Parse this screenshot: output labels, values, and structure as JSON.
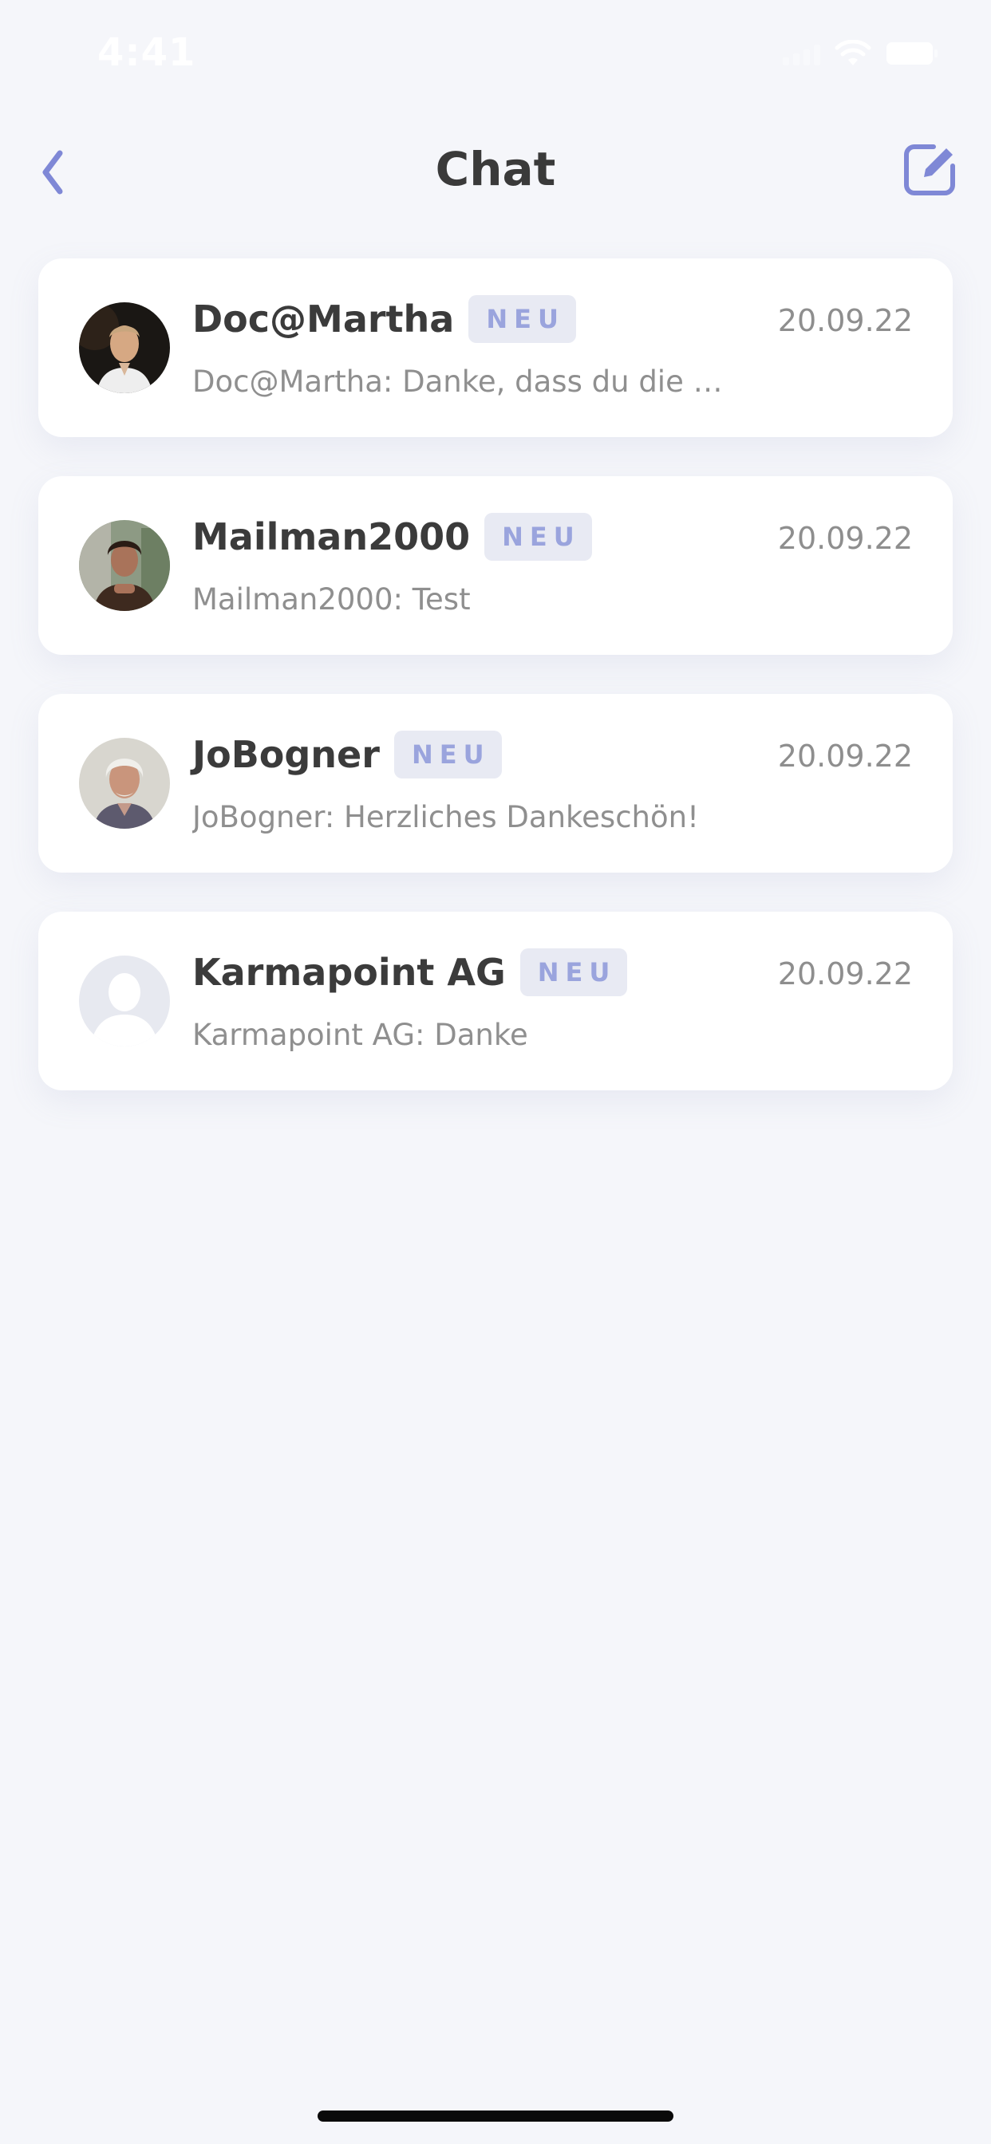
{
  "status_bar": {
    "time": "4:41"
  },
  "header": {
    "title": "Chat",
    "back_icon": "chevron-left-icon",
    "compose_icon": "edit-pencil-icon"
  },
  "colors": {
    "accent": "#7f88d6",
    "badge_bg": "#e8eaf3",
    "badge_text": "#9aa4dd",
    "background": "#f5f6fa",
    "card": "#ffffff"
  },
  "chats": [
    {
      "name": "Doc@Martha",
      "badge": "NEU",
      "date": "20.09.22",
      "preview": "Doc@Martha: Danke, dass du die …",
      "avatar": "photo"
    },
    {
      "name": "Mailman2000",
      "badge": "NEU",
      "date": "20.09.22",
      "preview": "Mailman2000: Test",
      "avatar": "photo"
    },
    {
      "name": "JoBogner",
      "badge": "NEU",
      "date": "20.09.22",
      "preview": "JoBogner: Herzliches Dankeschön!",
      "avatar": "photo"
    },
    {
      "name": "Karmapoint AG",
      "badge": "NEU",
      "date": "20.09.22",
      "preview": "Karmapoint AG: Danke",
      "avatar": "placeholder"
    }
  ]
}
